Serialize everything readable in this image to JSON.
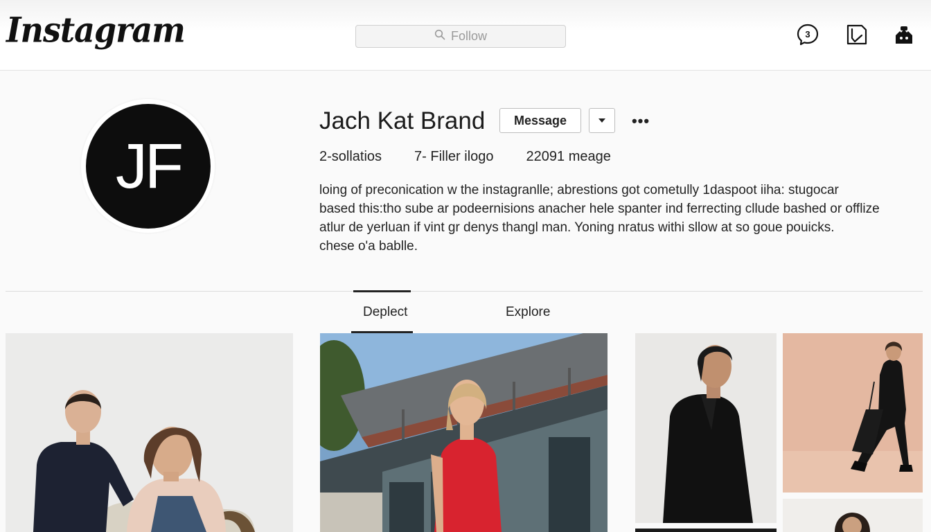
{
  "header": {
    "logo_text": "Instagram",
    "search_placeholder": "Follow",
    "icons": [
      "messenger-icon",
      "bookmark-icon",
      "notifications-icon"
    ],
    "notification_badge": "3"
  },
  "profile": {
    "avatar_initials": "JF",
    "username": "Jach Kat Brand",
    "message_label": "Message",
    "more_label": "•••",
    "stats": [
      "2-sollatios",
      "7- Filler ilogo",
      "22091 meage"
    ],
    "bio_lines": [
      "loing of preconication w the instagranlle; abrestions got cometully 1daspoot iiha: stugocar",
      "based this:tho sube ar podeernisions anacher hele spanter ind ferrecting cllude bashed or offlize",
      "atlur de yerluan if vint gr denys thangl man. Yoning nratus withi sllow at so goue pouicks.",
      "chese o'a bablle."
    ]
  },
  "tabs": [
    "Deplect",
    "Explore"
  ],
  "active_tab": "Deplect",
  "grid": {
    "posts": [
      "post-two-models-chair",
      "post-woman-red-dress-building",
      "post-woman-black-shirt",
      "post-woman-black-suit-bag",
      "post-bottom-left-partial",
      "post-bottom-right-partial"
    ]
  },
  "colors": {
    "accent": "#222222",
    "avatar_bg": "#0d0d0d",
    "background": "#fafafa"
  }
}
